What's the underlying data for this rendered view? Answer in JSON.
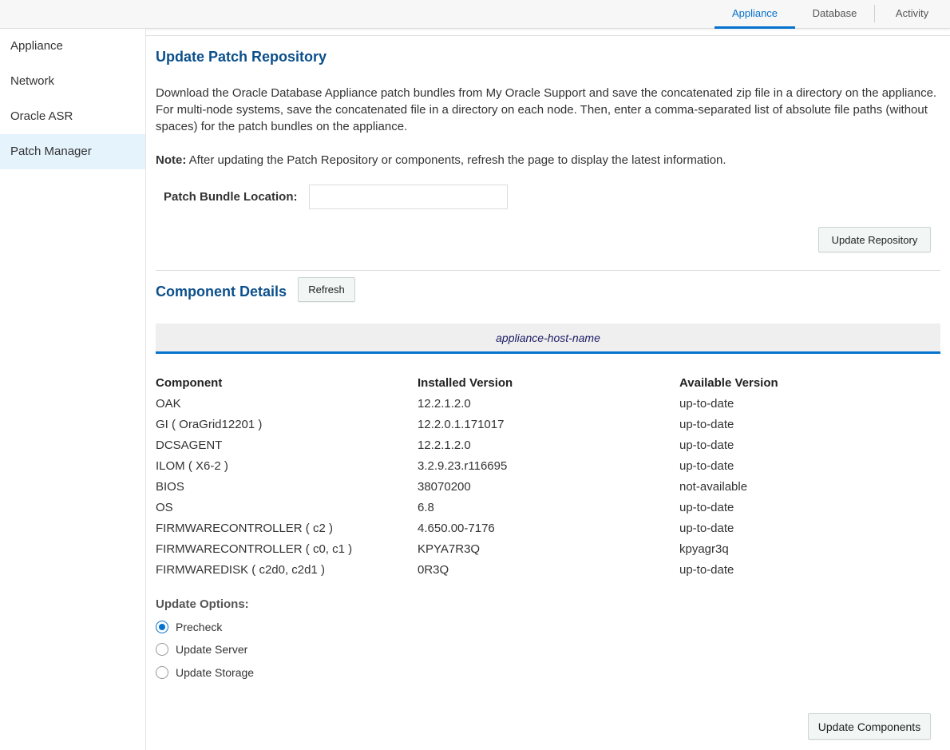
{
  "top_tabs": {
    "appliance": "Appliance",
    "database": "Database",
    "activity": "Activity"
  },
  "sidebar": {
    "items": [
      {
        "label": "Appliance"
      },
      {
        "label": "Network"
      },
      {
        "label": "Oracle ASR"
      },
      {
        "label": "Patch Manager"
      }
    ]
  },
  "repo": {
    "title": "Update Patch Repository",
    "description": "Download the Oracle Database Appliance patch bundles from My Oracle Support and save the concatenated zip file in a directory on the appliance. For multi-node systems, save the concatenated file in a directory on each node. Then, enter a comma-separated list of absolute file paths (without spaces) for the patch bundles on the appliance.",
    "note_label": "Note:",
    "note_text": " After updating the Patch Repository or components, refresh the page to display the latest information.",
    "location_label": "Patch Bundle Location:",
    "location_value": "",
    "update_button": "Update Repository"
  },
  "components": {
    "title": "Component Details",
    "refresh_button": "Refresh",
    "host_name": "appliance-host-name",
    "headers": {
      "component": "Component",
      "installed": "Installed Version",
      "available": "Available Version"
    },
    "rows": [
      {
        "component": "OAK",
        "installed": "12.2.1.2.0",
        "available": "up-to-date"
      },
      {
        "component": "GI ( OraGrid12201 )",
        "installed": "12.2.0.1.171017",
        "available": "up-to-date"
      },
      {
        "component": "DCSAGENT",
        "installed": "12.2.1.2.0",
        "available": "up-to-date"
      },
      {
        "component": "ILOM ( X6-2 )",
        "installed": "3.2.9.23.r116695",
        "available": "up-to-date"
      },
      {
        "component": "BIOS",
        "installed": "38070200",
        "available": "not-available"
      },
      {
        "component": "OS",
        "installed": "6.8",
        "available": "up-to-date"
      },
      {
        "component": "FIRMWARECONTROLLER ( c2 )",
        "installed": "4.650.00-7176",
        "available": "up-to-date"
      },
      {
        "component": "FIRMWARECONTROLLER ( c0, c1 )",
        "installed": "KPYA7R3Q",
        "available": "kpyagr3q"
      },
      {
        "component": "FIRMWAREDISK ( c2d0, c2d1 )",
        "installed": "0R3Q",
        "available": "up-to-date"
      }
    ]
  },
  "update_options": {
    "title": "Update Options:",
    "options": [
      {
        "label": "Precheck",
        "checked": true
      },
      {
        "label": "Update Server",
        "checked": false
      },
      {
        "label": "Update Storage",
        "checked": false
      }
    ],
    "update_button": "Update Components"
  },
  "colors": {
    "accent": "#0572ce",
    "heading": "#0b4f8c",
    "sidebar_active": "#e5f3fd"
  }
}
